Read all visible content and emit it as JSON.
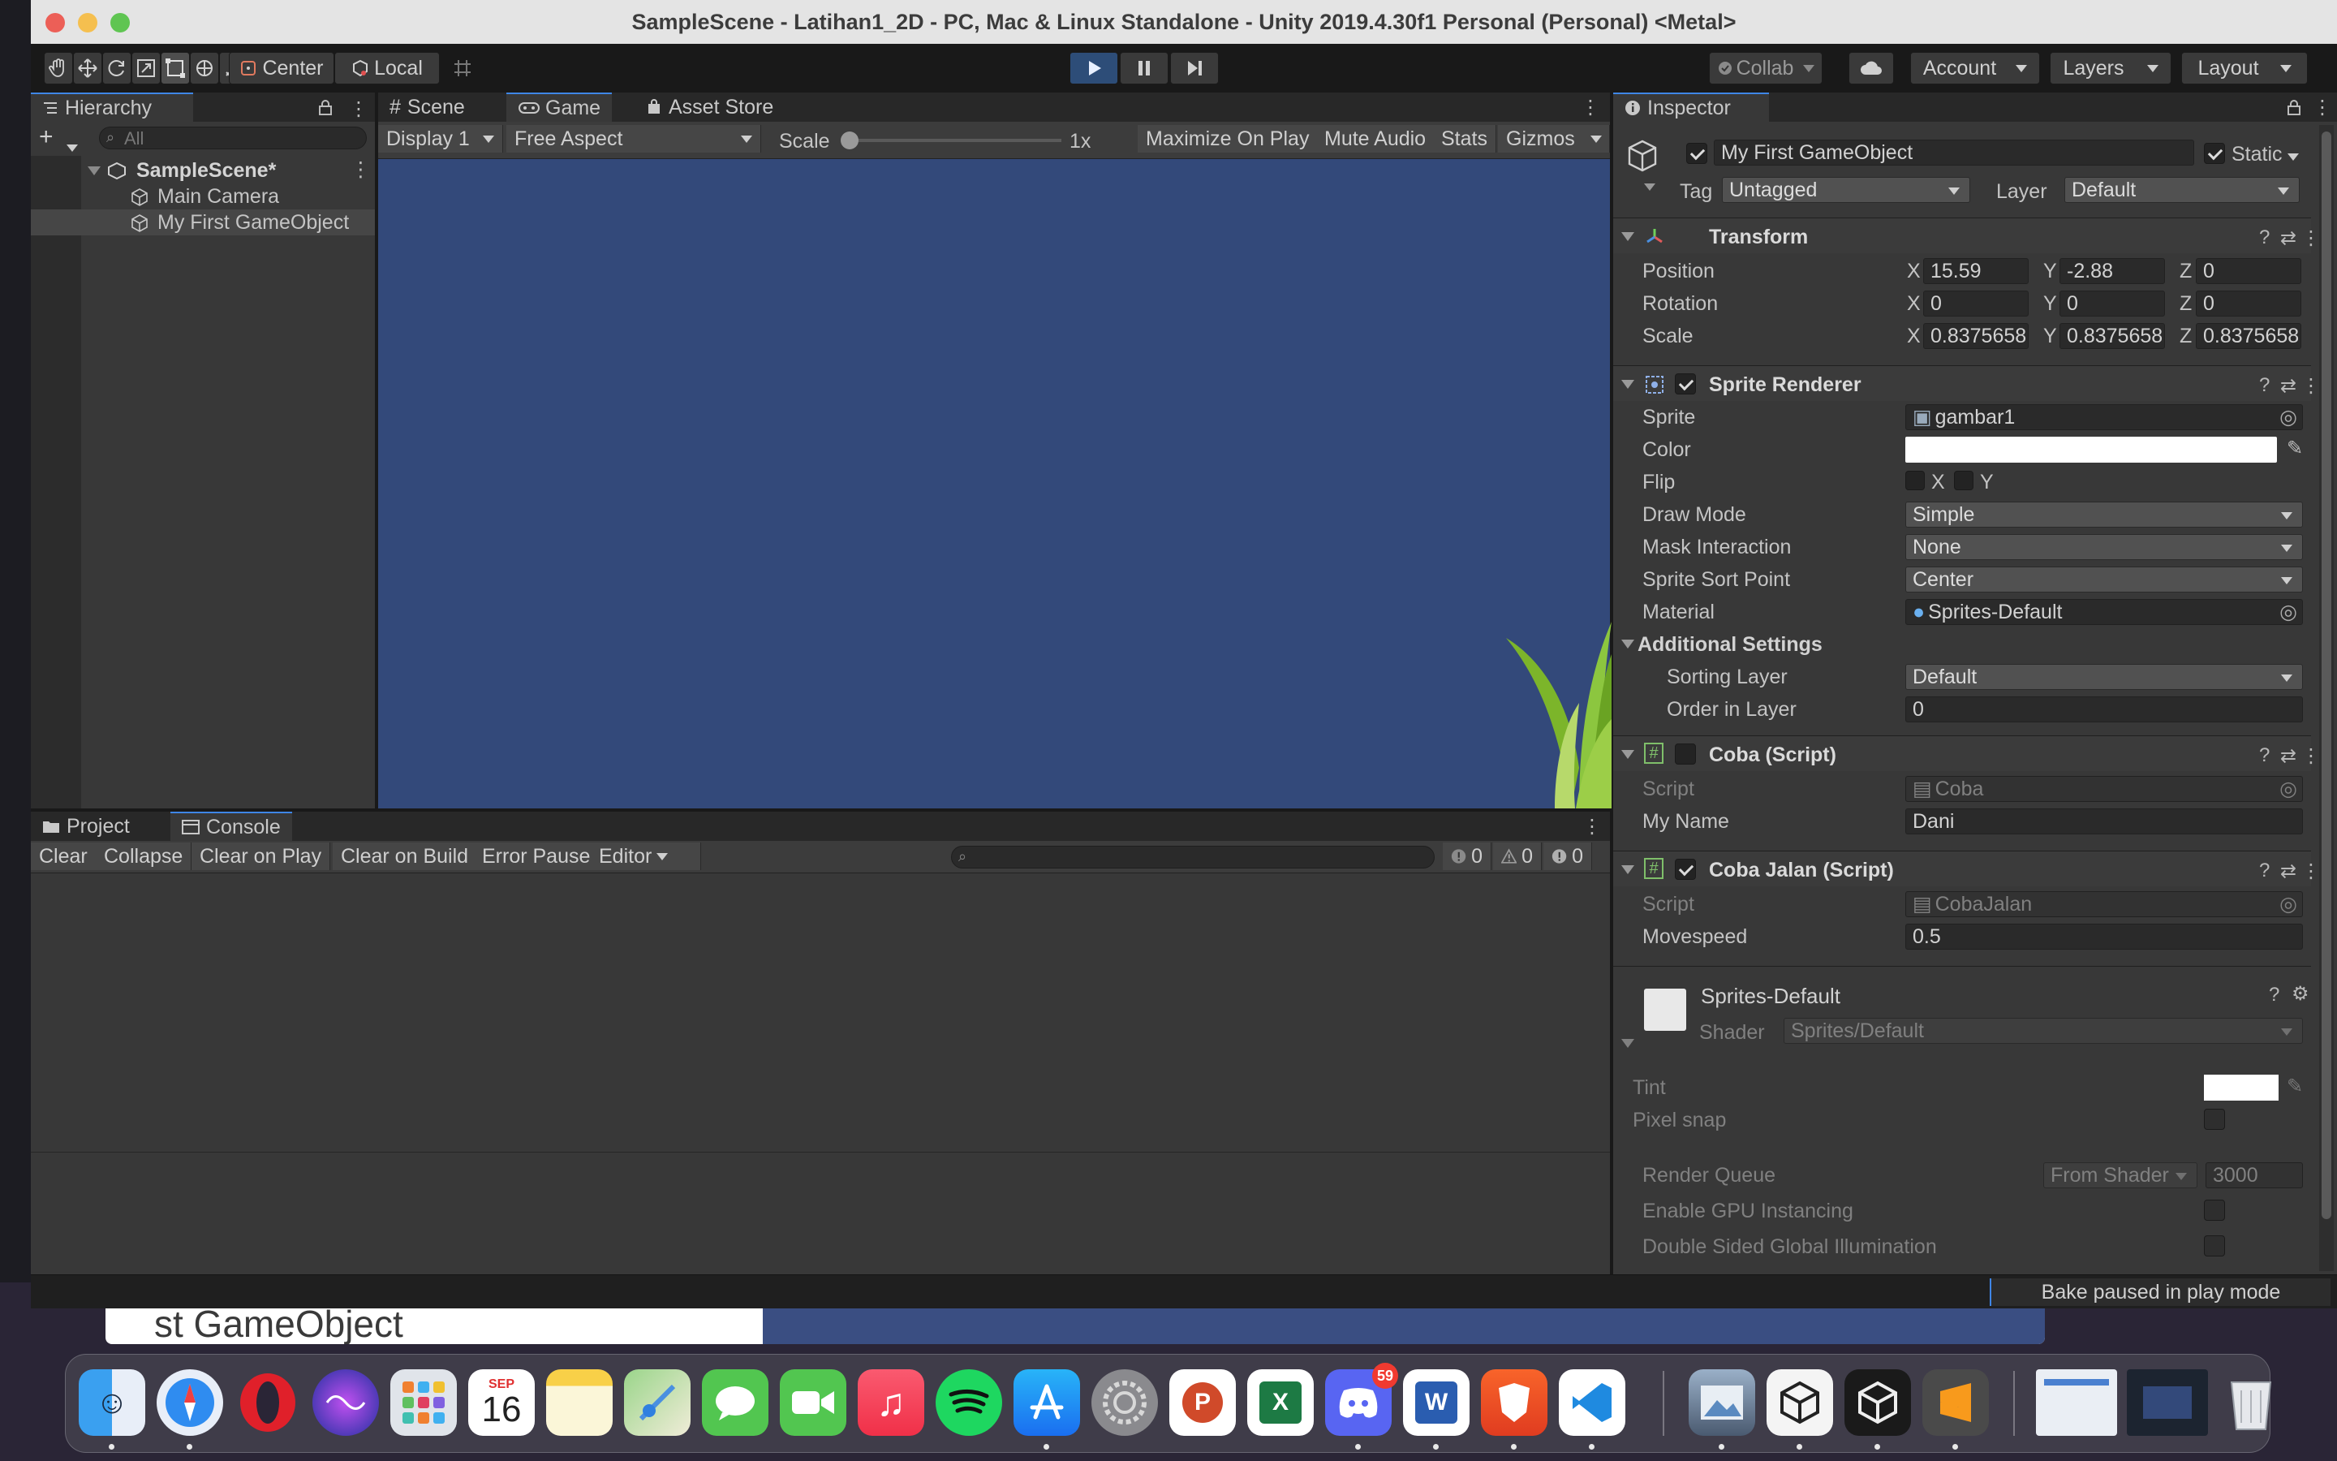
{
  "window": {
    "title": "SampleScene - Latihan1_2D - PC, Mac & Linux Standalone - Unity 2019.4.30f1 Personal (Personal) <Metal>"
  },
  "toolbar": {
    "tools": [
      "hand-tool",
      "move-tool",
      "rotate-tool",
      "scale-tool",
      "rect-tool",
      "transform-tool",
      "custom-tool"
    ],
    "pivot_label": "Center",
    "space_label": "Local",
    "collab_label": "Collab",
    "account_label": "Account",
    "layers_label": "Layers",
    "layout_label": "Layout",
    "play_state": "playing"
  },
  "hierarchy": {
    "tab_label": "Hierarchy",
    "search_placeholder": "All",
    "scene_name": "SampleScene*",
    "items": [
      {
        "label": "Main Camera"
      },
      {
        "label": "My First GameObject"
      }
    ]
  },
  "game": {
    "tabs": [
      {
        "label": "Scene"
      },
      {
        "label": "Game"
      },
      {
        "label": "Asset Store"
      }
    ],
    "display_label": "Display 1",
    "aspect_label": "Free Aspect",
    "scale_label": "Scale",
    "scale_value": "1x",
    "maximize_label": "Maximize On Play",
    "mute_label": "Mute Audio",
    "stats_label": "Stats",
    "gizmos_label": "Gizmos",
    "background_color": "#33497a"
  },
  "console": {
    "tabs": [
      {
        "label": "Project"
      },
      {
        "label": "Console"
      }
    ],
    "buttons": [
      "Clear",
      "Collapse",
      "Clear on Play",
      "Clear on Build",
      "Error Pause"
    ],
    "editor_label": "Editor",
    "counts": {
      "logs": "0",
      "warnings": "0",
      "errors": "0"
    }
  },
  "inspector": {
    "tab_label": "Inspector",
    "object_name": "My First GameObject",
    "static_label": "Static",
    "tag_label": "Tag",
    "tag_value": "Untagged",
    "layer_label": "Layer",
    "layer_value": "Default",
    "transform": {
      "title": "Transform",
      "position_label": "Position",
      "rotation_label": "Rotation",
      "scale_label": "Scale",
      "axis_x": "X",
      "axis_y": "Y",
      "axis_z": "Z",
      "position": [
        "15.59",
        "-2.88",
        "0"
      ],
      "rotation": [
        "0",
        "0",
        "0"
      ],
      "scale": [
        "0.8375658",
        "0.8375658",
        "0.8375658"
      ]
    },
    "sprite_renderer": {
      "title": "Sprite Renderer",
      "sprite_label": "Sprite",
      "sprite_value": "gambar1",
      "color_label": "Color",
      "color_value": "#ffffff",
      "flip_label": "Flip",
      "flip_x": "X",
      "flip_y": "Y",
      "draw_mode_label": "Draw Mode",
      "draw_mode_value": "Simple",
      "mask_label": "Mask Interaction",
      "mask_value": "None",
      "sort_point_label": "Sprite Sort Point",
      "sort_point_value": "Center",
      "material_label": "Material",
      "material_value": "Sprites-Default",
      "additional_label": "Additional Settings",
      "sorting_layer_label": "Sorting Layer",
      "sorting_layer_value": "Default",
      "order_label": "Order in Layer",
      "order_value": "0"
    },
    "coba_script": {
      "title": "Coba (Script)",
      "script_label": "Script",
      "script_value": "Coba",
      "my_name_label": "My Name",
      "my_name_value": "Dani"
    },
    "coba_jalan": {
      "title": "Coba Jalan (Script)",
      "script_label": "Script",
      "script_value": "CobaJalan",
      "movespeed_label": "Movespeed",
      "movespeed_value": "0.5"
    },
    "material": {
      "name": "Sprites-Default",
      "shader_label": "Shader",
      "shader_value": "Sprites/Default",
      "tint_label": "Tint",
      "pixel_snap_label": "Pixel snap",
      "render_queue_label": "Render Queue",
      "render_queue_source": "From Shader",
      "render_queue_value": "3000",
      "gpu_instancing_label": "Enable GPU Instancing",
      "double_sided_label": "Double Sided Global Illumination"
    }
  },
  "status": {
    "bake_message": "Bake paused in play mode"
  },
  "background_window": {
    "title_fragment": "st GameObject"
  },
  "dock": {
    "calendar_month": "SEP",
    "calendar_day": "16",
    "discord_badge": "59",
    "apps": [
      "finder-icon",
      "safari-icon",
      "opera-icon",
      "siri-icon",
      "launchpad-icon",
      "calendar-icon",
      "notes-icon",
      "maps-icon",
      "messages-icon",
      "facetime-icon",
      "music-icon",
      "spotify-icon",
      "app-store-icon",
      "system-preferences-icon",
      "powerpoint-icon",
      "excel-icon",
      "discord-icon",
      "word-icon",
      "brave-icon",
      "vscode-icon",
      "preview-icon",
      "unity-hub-icon",
      "unity-icon",
      "sublime-icon",
      "window-thumb-icon",
      "window-thumb-icon",
      "trash-icon"
    ]
  }
}
